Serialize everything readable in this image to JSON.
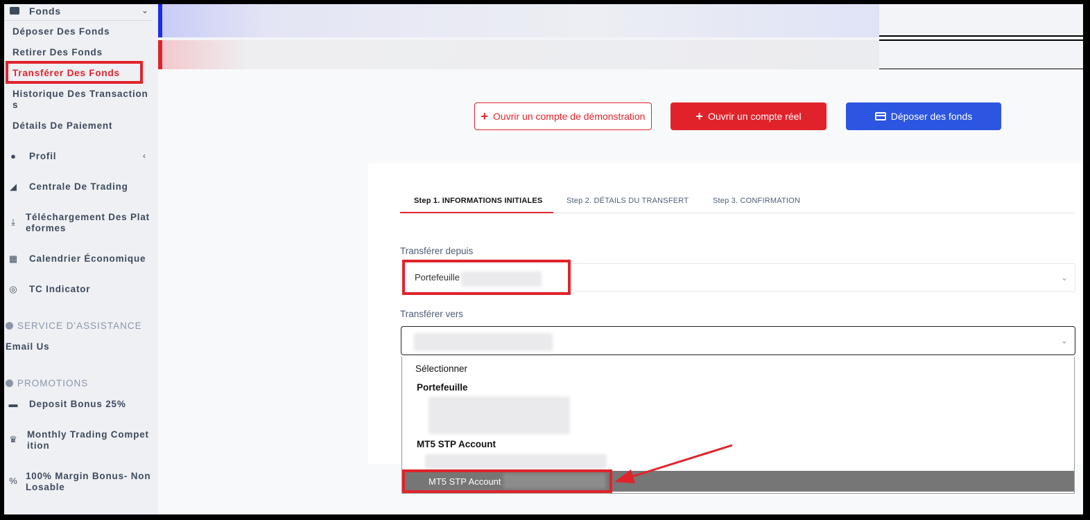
{
  "sidebar": {
    "funds_header": "Fonds",
    "sub_items": [
      {
        "label": "Déposer Des Fonds"
      },
      {
        "label": "Retirer Des Fonds"
      },
      {
        "label": "Transférer Des Fonds"
      },
      {
        "label": "Historique Des Transaction s"
      },
      {
        "label": "Détails De Paiement"
      }
    ],
    "nav": [
      {
        "label": "Profil",
        "icon": "user-icon"
      },
      {
        "label": "Centrale De Trading",
        "icon": "chart-icon"
      },
      {
        "label": "Téléchargement Des Plat eformes",
        "icon": "download-icon"
      },
      {
        "label": "Calendrier Économique",
        "icon": "calendar-icon"
      },
      {
        "label": "TC Indicator",
        "icon": "target-icon"
      }
    ],
    "support_section": "SERVICE D'ASSISTANCE",
    "email_us": "Email Us",
    "promotions_section": "PROMOTIONS",
    "promos": [
      {
        "label": "Deposit Bonus 25%",
        "icon": "wallet-icon"
      },
      {
        "label": "Monthly Trading Compet ition",
        "icon": "trophy-icon"
      },
      {
        "label": "100% Margin Bonus- Non Losable",
        "icon": "percent-icon"
      }
    ]
  },
  "actions": {
    "demo": "Ouvrir un compte de démonstration",
    "real": "Ouvrir un compte réel",
    "deposit": "Déposer des fonds"
  },
  "steps": [
    {
      "label": "Step 1. INFORMATIONS INITIALES"
    },
    {
      "label": "Step 2. DÉTAILS DU TRANSFERT"
    },
    {
      "label": "Step 3. CONFIRMATION"
    }
  ],
  "form": {
    "from_label": "Transférer depuis",
    "from_value": "Portefeuille",
    "to_label": "Transférer vers"
  },
  "dropdown": {
    "placeholder": "Sélectionner",
    "group1": "Portefeuille",
    "group2": "MT5 STP Account",
    "selected": "MT5 STP Account"
  },
  "colors": {
    "accent_red": "#e0232b",
    "accent_blue": "#2c56e1",
    "sidebar_text": "#3d4a5c"
  }
}
